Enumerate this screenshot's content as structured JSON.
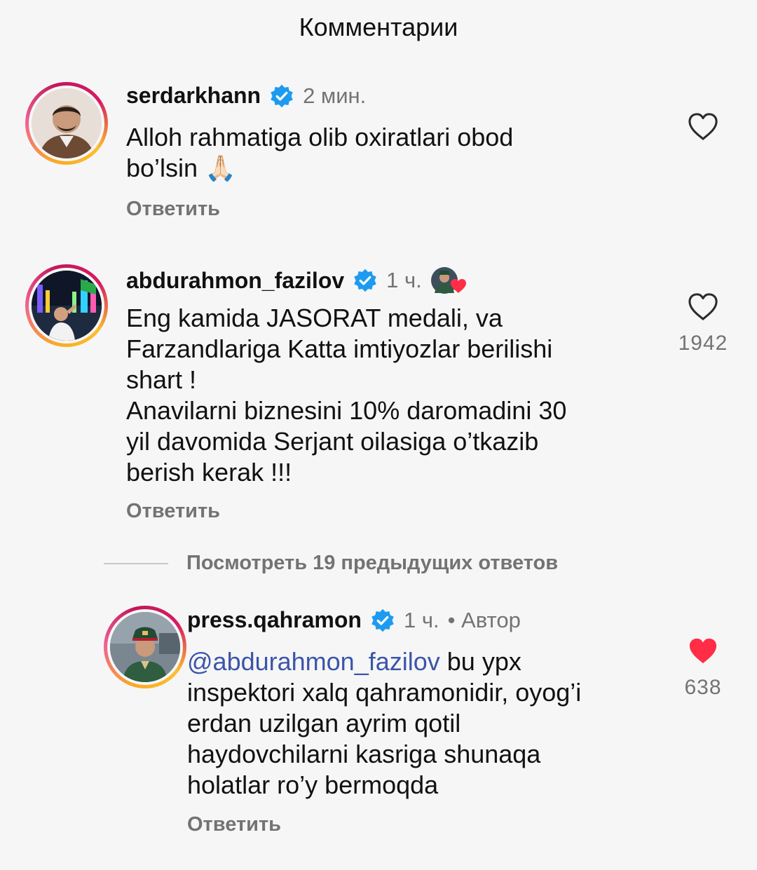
{
  "header": {
    "title": "Комментарии"
  },
  "comments": [
    {
      "username": "serdarkhann",
      "time": "2 мин.",
      "text": "Alloh rahmatiga olib oxiratlari obod\nbo’lsin",
      "emoji": "🙏🏻",
      "reply_label": "Ответить",
      "likes": "",
      "liked": false
    },
    {
      "username": "abdurahmon_fazilov",
      "time": "1 ч.",
      "text": "Eng kamida JASORAT medali, va\nFarzandlariga Katta imtiyozlar berilishi\nshart !\nAnavilarni biznesini 10% daromadini  30\nyil davomida Serjant oilasiga o’tkazib\nberish kerak !!!",
      "reply_label": "Ответить",
      "likes": "1942",
      "liked": false,
      "author_liked": true
    }
  ],
  "view_replies": {
    "label": "Посмотреть 19 предыдущих ответов"
  },
  "reply": {
    "username": "press.qahramon",
    "time": "1 ч.",
    "author_badge": "• Автор",
    "mention": "@abdurahmon_fazilov",
    "text": " bu ypx\ninspektori xalq qahramonidir, oyog’i\nerdan uzilgan ayrim qotil\nhaydovchilarni kasriga shunaqa\nholatlar  ro’y bermoqda",
    "reply_label": "Ответить",
    "likes": "638",
    "liked": true
  },
  "colors": {
    "background": "#f6f6f7",
    "text": "#111111",
    "secondary": "#737373",
    "verified": "#1d9bf0",
    "liked_heart": "#ff2d46",
    "mention": "#3b55a8"
  }
}
